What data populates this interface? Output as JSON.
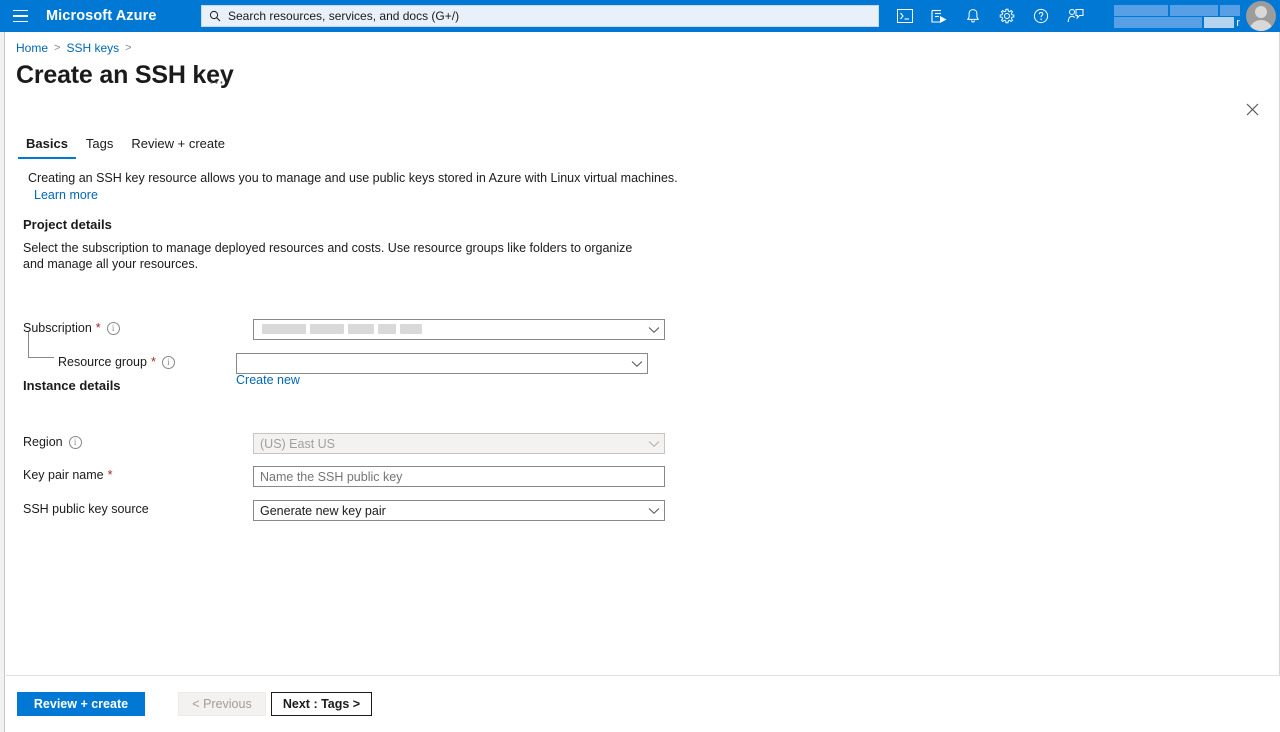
{
  "topbar": {
    "menu_icon": "hamburger-icon",
    "brand": "Microsoft Azure",
    "search_placeholder": "Search resources, services, and docs (G+/)",
    "search_value": "",
    "icons": [
      {
        "name": "cloud-shell-icon",
        "title": "Cloud Shell"
      },
      {
        "name": "directories-subscriptions-icon",
        "title": "Directories + subscriptions"
      },
      {
        "name": "notifications-bell-icon",
        "title": "Notifications"
      },
      {
        "name": "settings-gear-icon",
        "title": "Settings"
      },
      {
        "name": "help-question-icon",
        "title": "Help"
      },
      {
        "name": "feedback-icon",
        "title": "Feedback"
      }
    ],
    "account_redacted_char": "r"
  },
  "breadcrumb": {
    "items": [
      "Home",
      "SSH keys"
    ],
    "separator": ">"
  },
  "header": {
    "title": "Create an SSH key",
    "ellipsis": "⋯",
    "close_icon": "close-icon"
  },
  "tabs": [
    {
      "label": "Basics",
      "active": true
    },
    {
      "label": "Tags",
      "active": false
    },
    {
      "label": "Review + create",
      "active": false
    }
  ],
  "intro": {
    "text": "Creating an SSH key resource allows you to manage and use public keys stored in Azure with Linux virtual machines.",
    "learn_more": "Learn more"
  },
  "project_details": {
    "heading": "Project details",
    "description": "Select the subscription to manage deployed resources and costs. Use resource groups like folders to organize and manage all your resources.",
    "subscription": {
      "label": "Subscription",
      "required": "*",
      "value": "",
      "redacted": true
    },
    "resource_group": {
      "label": "Resource group",
      "required": "*",
      "value": "",
      "create_new": "Create new"
    }
  },
  "instance_details": {
    "heading": "Instance details",
    "region": {
      "label": "Region",
      "value": "(US) East US",
      "disabled": true
    },
    "key_pair_name": {
      "label": "Key pair name",
      "required": "*",
      "value": "",
      "placeholder": "Name the SSH public key"
    },
    "ssh_public_key_source": {
      "label": "SSH public key source",
      "value": "Generate new key pair"
    }
  },
  "footer": {
    "review_create": "Review + create",
    "previous": "< Previous",
    "next": "Next : Tags >"
  },
  "colors": {
    "azure_blue": "#0078d4",
    "link_blue": "#0067b8",
    "required_red": "#a4262c",
    "border_gray": "#8a8886",
    "disabled_bg": "#f3f2f1"
  }
}
